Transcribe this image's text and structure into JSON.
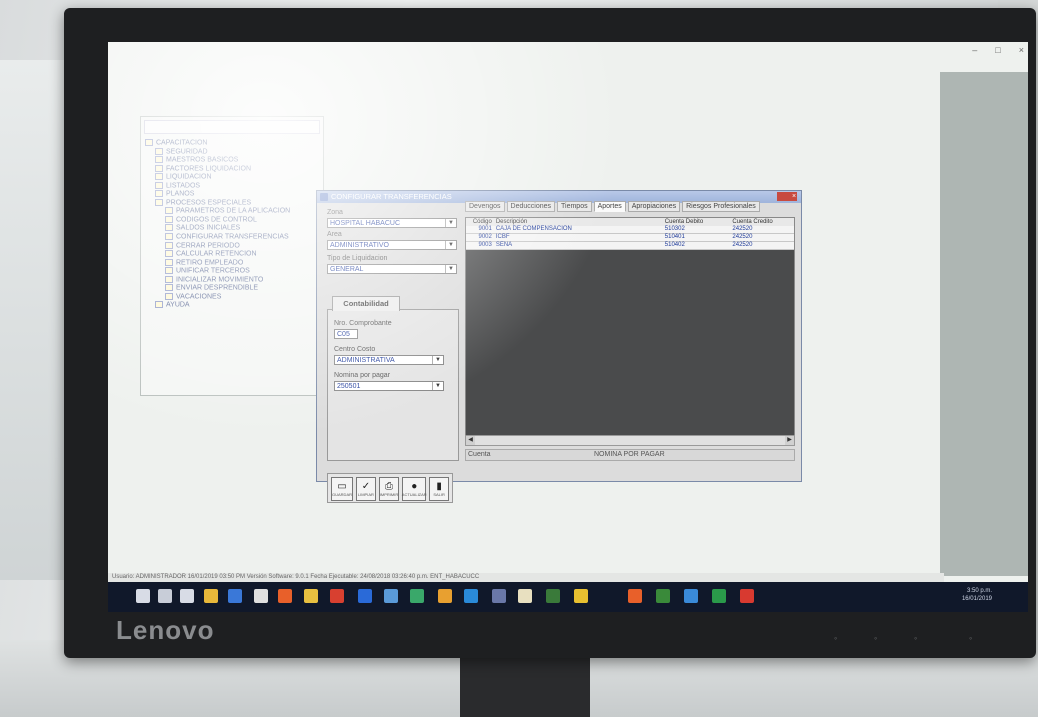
{
  "monitor": {
    "brand": "Lenovo"
  },
  "window": {
    "controls": [
      "–",
      "□",
      "×"
    ]
  },
  "tree": {
    "items": [
      {
        "label": "CAPACITACION",
        "indent": 0
      },
      {
        "label": "SEGURIDAD",
        "indent": 1
      },
      {
        "label": "MAESTROS BASICOS",
        "indent": 1
      },
      {
        "label": "FACTORES LIQUIDACION",
        "indent": 1
      },
      {
        "label": "LIQUIDACION",
        "indent": 1
      },
      {
        "label": "LISTADOS",
        "indent": 1
      },
      {
        "label": "PLANOS",
        "indent": 1
      },
      {
        "label": "PROCESOS ESPECIALES",
        "indent": 1
      },
      {
        "label": "PARAMETROS DE LA APLICACION",
        "indent": 2
      },
      {
        "label": "CODIGOS DE CONTROL",
        "indent": 2
      },
      {
        "label": "SALDOS INICIALES",
        "indent": 2
      },
      {
        "label": "CONFIGURAR TRANSFERENCIAS",
        "indent": 2
      },
      {
        "label": "CERRAR PERIODO",
        "indent": 2
      },
      {
        "label": "CALCULAR RETENCION",
        "indent": 2
      },
      {
        "label": "RETIRO EMPLEADO",
        "indent": 2
      },
      {
        "label": "UNIFICAR TERCEROS",
        "indent": 2
      },
      {
        "label": "INICIALIZAR MOVIMIENTO",
        "indent": 2
      },
      {
        "label": "ENVIAR DESPRENDIBLE",
        "indent": 2
      },
      {
        "label": "VACACIONES",
        "indent": 2
      },
      {
        "label": "AYUDA",
        "indent": 1
      }
    ]
  },
  "dialog": {
    "title": "CONFIGURAR TRANSFERENCIAS",
    "close": "×",
    "zona_label": "Zona",
    "zona_value": "HOSPITAL HABACUC",
    "area_label": "Area",
    "area_value": "ADMINISTRATIVO",
    "tipo_label": "Tipo de Liquidacion",
    "tipo_value": "GENERAL",
    "contabilidad_tab": "Contabilidad",
    "comprobante_label": "Nro. Comprobante",
    "comprobante_value": "C05",
    "centro_label": "Centro  Costo",
    "centro_value": "ADMINISTRATIVA",
    "nomina_label": "Nomina por pagar",
    "nomina_value": "250501",
    "tabs": [
      "Devengos",
      "Deducciones",
      "Tiempos",
      "Aportes",
      "Apropiaciones",
      "Riesgos Profesionales"
    ],
    "active_tab": 3,
    "grid_headers": [
      "Código",
      "Descripción",
      "Cuenta Debito",
      "Cuenta Credito"
    ],
    "rows": [
      {
        "codigo": "9001",
        "descripcion": "CAJA DE COMPENSACION",
        "debito": "510302",
        "credito": "242520"
      },
      {
        "codigo": "9002",
        "descripcion": "ICBF",
        "debito": "510401",
        "credito": "242520"
      },
      {
        "codigo": "9003",
        "descripcion": "SENA",
        "debito": "510402",
        "credito": "242520"
      }
    ],
    "status_left": "Cuenta",
    "status_right": "NOMINA POR PAGAR",
    "toolbar": [
      {
        "name": "guardar",
        "glyph": "▭",
        "caption": "GUARDAR"
      },
      {
        "name": "limpiar",
        "glyph": "✓",
        "caption": "LIMPIAR"
      },
      {
        "name": "imprimir",
        "glyph": "⎙",
        "caption": "IMPRIMIR"
      },
      {
        "name": "actualizar",
        "glyph": "●",
        "caption": "ACTUALIZAR"
      },
      {
        "name": "salir",
        "glyph": "▮",
        "caption": "SALIR"
      }
    ]
  },
  "status_bar": "Usuario: ADMINISTRADOR   16/01/2019 03:50 PM   Versión Software: 9.0.1   Fecha Ejecutable: 24/08/2018 03:26:40 p.m.   ENT_HABACUCC",
  "clock": {
    "time": "3:50 p.m.",
    "date": "16/01/2019"
  },
  "colors": {
    "taskbar": "#10182a",
    "title_bar": "#9fb4dc",
    "grid_bg": "#4a4b4c"
  }
}
